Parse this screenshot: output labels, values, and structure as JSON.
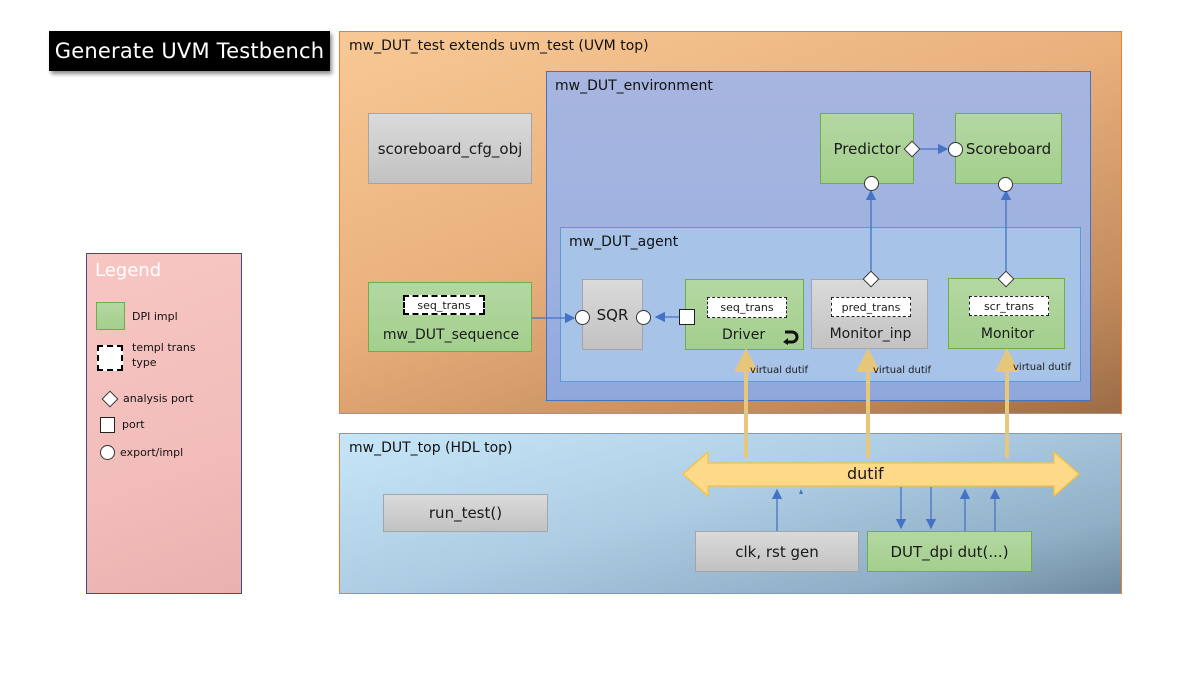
{
  "title_button": "Generate UVM Testbench",
  "legend": {
    "title": "Legend",
    "items": [
      {
        "icon": "green-box",
        "label": "DPI impl"
      },
      {
        "icon": "dashed-box",
        "label_line1": "templ trans",
        "label_line2": "type"
      },
      {
        "icon": "diamond",
        "label": "analysis port"
      },
      {
        "icon": "square",
        "label": "port"
      },
      {
        "icon": "circle",
        "label": "export/impl"
      }
    ]
  },
  "uvm_top": {
    "label": "mw_DUT_test extends uvm_test (UVM top)",
    "scoreboard_cfg": "scoreboard_cfg_obj",
    "sequence": {
      "label": "mw_DUT_sequence",
      "trans": "seq_trans"
    },
    "environment": {
      "label": "mw_DUT_environment",
      "predictor": "Predictor",
      "scoreboard": "Scoreboard",
      "agent": {
        "label": "mw_DUT_agent",
        "sqr": "SQR",
        "driver": {
          "label": "Driver",
          "trans": "seq_trans",
          "vif": "virtual dutif"
        },
        "monitor_inp": {
          "label": "Monitor_inp",
          "trans": "pred_trans",
          "vif": "virtual dutif"
        },
        "monitor": {
          "label": "Monitor",
          "trans": "scr_trans",
          "vif": "virtual dutif"
        }
      }
    }
  },
  "hdl_top": {
    "label": "mw_DUT_top  (HDL top)",
    "run_test": "run_test()",
    "bus": "dutif",
    "clk_gen": "clk, rst gen",
    "dut": "DUT_dpi dut(...)"
  },
  "colors": {
    "uvm_top_border": "#ed7d31",
    "env_border": "#4472c4",
    "dpi_green": "#a9d18e",
    "bus_yellow": "#ffd580",
    "connector_blue": "#4472c4"
  }
}
